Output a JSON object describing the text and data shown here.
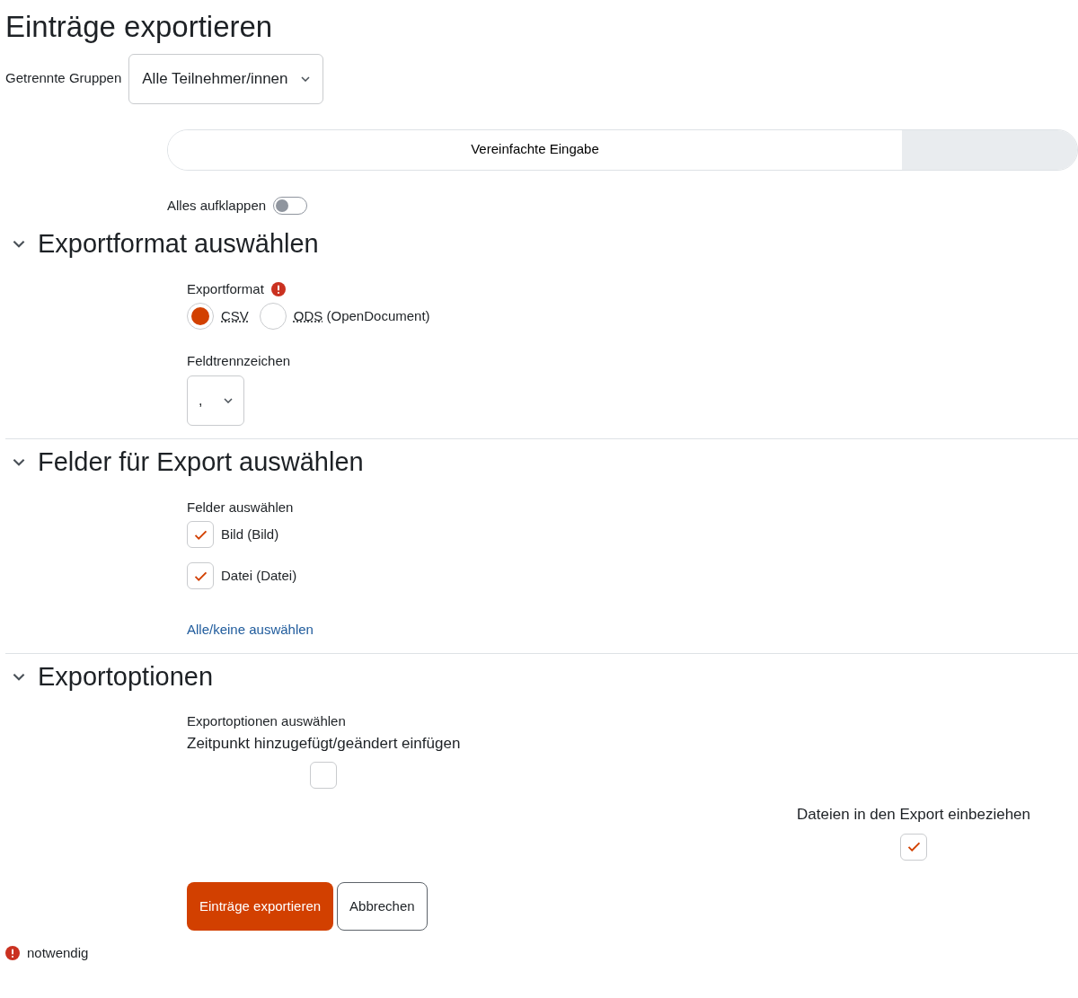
{
  "title": "Einträge exportieren",
  "group_select": {
    "label": "Getrennte Gruppen",
    "value": "Alle Teilnehmer/innen"
  },
  "mode_tabs": [
    {
      "label": "Vereinfachte Eingabe",
      "selected": true
    },
    {
      "selected": false
    }
  ],
  "expand_all": {
    "label": "Alles aufklappen",
    "on": false
  },
  "sections": [
    {
      "kind": "format",
      "title": "Exportformat auswählen",
      "expanded": true,
      "format_label": "Exportformat",
      "required": true,
      "options": [
        {
          "abbr": "CSV",
          "selected": true
        },
        {
          "abbr": "ODS",
          "rest": "(OpenDocument)",
          "selected": false
        }
      ],
      "delimiter_label": "Feldtrennzeichen",
      "delimiter_value": ","
    },
    {
      "kind": "fields",
      "title": "Felder für Export auswählen",
      "expanded": true,
      "fields_label": "Felder auswählen",
      "fields": [
        {
          "label": "Bild (Bild)",
          "checked": true
        },
        {
          "label": "Datei (Datei)",
          "checked": true
        }
      ],
      "toggle_link": "Alle/keine auswählen"
    },
    {
      "kind": "options",
      "title": "Exportoptionen",
      "expanded": true,
      "options_label": "Exportoptionen auswählen",
      "options": [
        {
          "label": "Zeitpunkt hinzugefügt/geändert einfügen",
          "checked": false
        },
        {
          "label": "Dateien in den Export einbeziehen",
          "checked": true
        }
      ]
    }
  ],
  "buttons": [
    {
      "kind": "primary",
      "label": "Einträge exportieren"
    },
    {
      "kind": "secondary",
      "label": "Abbrechen"
    }
  ],
  "required_note": "notwendig"
}
